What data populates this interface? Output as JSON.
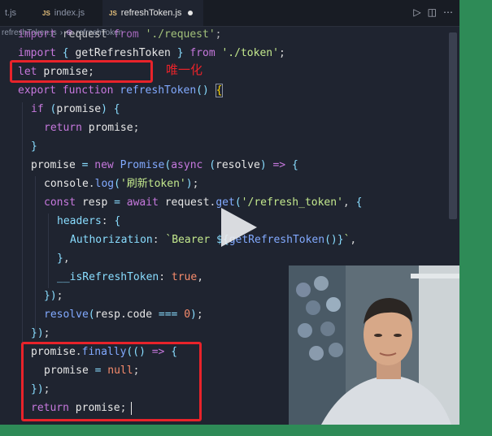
{
  "editor": {
    "tabs": [
      {
        "label": "t.js",
        "active": false
      },
      {
        "label": "index.js",
        "active": false
      },
      {
        "label": "refreshToken.js",
        "active": true,
        "modified": true
      }
    ],
    "breadcrumb": {
      "file": "refreshToken.js",
      "symbol": "refreshToken"
    }
  },
  "code_lines": [
    "import request from './request';",
    "import { getRefreshToken } from './token';",
    "let promise;",
    "export function refreshToken() {",
    "  if (promise) {",
    "    return promise;",
    "  }",
    "  promise = new Promise(async (resolve) => {",
    "    console.log('刷新token');",
    "    const resp = await request.get('/refresh_token', {",
    "      headers: {",
    "        Authorization: `Bearer ${getRefreshToken()}`,",
    "      },",
    "      __isRefreshToken: true,",
    "    });",
    "    resolve(resp.code === 0);",
    "  });",
    "  promise.finally(() => {",
    "    promise = null;",
    "  });",
    "  return promise;"
  ],
  "annotation": {
    "label": "唯一化",
    "color": "#e8232a"
  },
  "colors": {
    "background": "#2e8b57",
    "editor_bg": "#1f2430",
    "keyword": "#c678dd",
    "function": "#82aaff",
    "string": "#c3e88d"
  }
}
